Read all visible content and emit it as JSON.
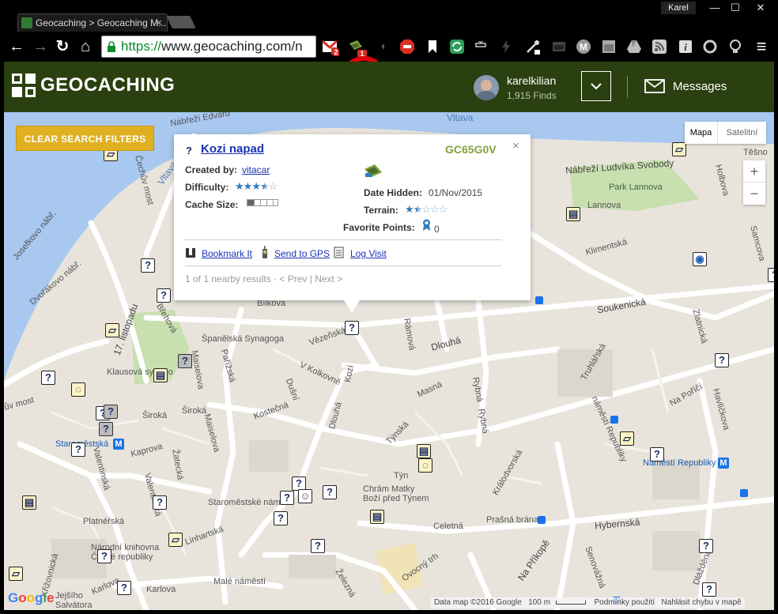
{
  "browser": {
    "tab_title": "Geocaching > Geocaching M...",
    "tab_close": "×",
    "username": "Karel",
    "min": "—",
    "max": "☐",
    "close": "✕",
    "url_scheme": "https://",
    "url_rest": "www.geocaching.com/n",
    "gmail_badge": "2",
    "gc_ext_badge": "1",
    "star": "☆",
    "back": "←",
    "forward": "→",
    "reload": "↻",
    "home": "⌂",
    "menu": "≡"
  },
  "header": {
    "brand": "GEOCACHING",
    "user_name": "karelkilian",
    "user_finds": "1,915 Finds",
    "dropdown": "⌄",
    "messages": "Messages"
  },
  "map": {
    "clear_filters": "CLEAR SEARCH FILTERS",
    "map_type_map": "Mapa",
    "map_type_satellite": "Satelitní",
    "zoom_in": "+",
    "zoom_out": "−",
    "attribution_data": "Data map ©2016 Google",
    "attribution_scale": "100 m",
    "attribution_terms": "Podmínky použití",
    "attribution_report": "Nahlásit chybu v mapě",
    "google": "Google",
    "streets": {
      "vltava": "Vltava",
      "vltava2": "Vltava",
      "nabrezi_edvarda": "Nábřeží Edvard",
      "nabrezi_ludvika": "Nábřeží Ludvíka Svobody",
      "cechuv_most": "Čechův most",
      "park_lannova": "Park Lannova",
      "holbova": "Holbova",
      "tesnov": "Těšno",
      "lannova": "Lannova",
      "klimentska": "Klimentská",
      "samcova": "Samcova",
      "dvorakovo": "Dvořákovo nábř.",
      "rasinovo": "Josefkovo nábř.",
      "listopadu": "17. listopadu",
      "brehova": "Břehová",
      "bilkova": "Bílkova",
      "spanelska": "Španělská Synagoga",
      "vezenska": "Vězeňská",
      "ramova": "Rámová",
      "dlouha": "Dlouhá",
      "soukenicka": "Soukenická",
      "zlatnicka": "Zlatnická",
      "truhlarska": "Truhlářská",
      "klausova": "Klausová synago",
      "maiselova": "Maiselova",
      "parizska": "Pařížská",
      "vkolkovne": "V Kolkovně",
      "kozi": "Kozí",
      "masna": "Masná",
      "rybna": "Rybná",
      "namesti_rep": "náměstí Republiky",
      "naporici": "Na Poříčí",
      "havlickova": "Havlíčkova",
      "vrmost": "ův most",
      "siroka": "Široká",
      "siroka2": "Široká",
      "dusni": "Dušní",
      "kostecna": "Kostečná",
      "dlouha2": "Dlouhá",
      "tynska": "Týnská",
      "kralodvorska": "Králodvorská",
      "staromestska": "Staroměstská",
      "kaprova": "Kaprova",
      "zatecka": "Žatecká",
      "salvatorska": "Salvátorská",
      "valentinska": "Valentinská",
      "tyn": "Týn",
      "chram": "Chrám Matky Boží před Týnem",
      "staromestske_nam": "Staroměstské nám",
      "celetna": "Celetná",
      "prasna_brana": "Prašná brána",
      "hybernska": "Hybernská",
      "platnerska": "Platnéřská",
      "linhartska": "Linhartská",
      "narodni_knihovna": "Národní knihovna České republiky",
      "male_namesti": "Malé náměstí",
      "zelezna": "Železná",
      "ovocny_trh": "Ovocný trh",
      "naprikope": "Na Příkopě",
      "senovazna": "Senovážná",
      "dlazdena": "Dlážděná",
      "krizovnicka": "Křižovnická",
      "karlova": "Karlova",
      "karlova2": "Karlova",
      "bethlehem": "Betlémské",
      "salvatora": "Salvátora",
      "jejsi": "Jejšího"
    },
    "metro": {
      "staromestska": "Staroměstská",
      "namesti_republiky": "Náměstí Republiky",
      "m": "M"
    }
  },
  "popup": {
    "title": "Kozi napad",
    "code": "GC65G0V",
    "close": "×",
    "created_by_label": "Created by:",
    "created_by": "vitacar",
    "difficulty_label": "Difficulty:",
    "cache_size_label": "Cache Size:",
    "date_hidden_label": "Date Hidden:",
    "date_hidden": "01/Nov/2015",
    "terrain_label": "Terrain:",
    "favorite_label": "Favorite Points:",
    "favorite_points": "0",
    "difficulty": 3.5,
    "terrain": 1.5,
    "bookmark": "Bookmark It",
    "send_gps": "Send to GPS",
    "log_visit": "Log Visit",
    "nearby": "1 of 1 nearby results · < Prev | Next >"
  },
  "colors": {
    "header_bg": "#2b4010",
    "clear_btn": "#e0b021",
    "river": "#a8c8f0",
    "park": "#c8dfb0",
    "code": "#86a13f"
  }
}
